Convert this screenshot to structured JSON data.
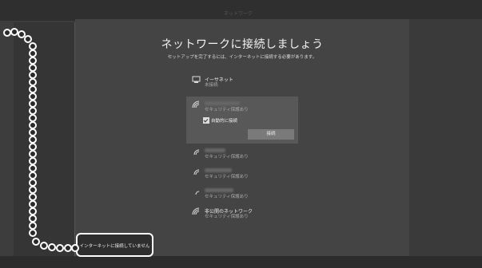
{
  "header": {
    "label": "ネットワーク"
  },
  "main": {
    "title": "ネットワークに接続しましょう",
    "subtitle": "セットアップを完了するには、インターネットに接続する必要があります。"
  },
  "ethernet": {
    "name": "イーサネット",
    "status": "未接続"
  },
  "networks": [
    {
      "status": "セキュリティ保護あり"
    },
    {
      "status": "セキュリティ保護あり"
    },
    {
      "status": "セキュリティ保護あり"
    },
    {
      "status": "セキュリティ保護あり"
    }
  ],
  "selected_network": {
    "status": "セキュリティ保護あり",
    "auto_connect_label": "自動的に接続",
    "auto_connect_checked": true,
    "connect_label": "接続"
  },
  "hidden_network": {
    "name": "非公開のネットワーク",
    "status": "セキュリティ保護あり"
  },
  "callout": {
    "label": "インターネットに接続していません"
  },
  "icons": {
    "ethernet": "ethernet-icon",
    "wifi": "wifi-icon"
  }
}
